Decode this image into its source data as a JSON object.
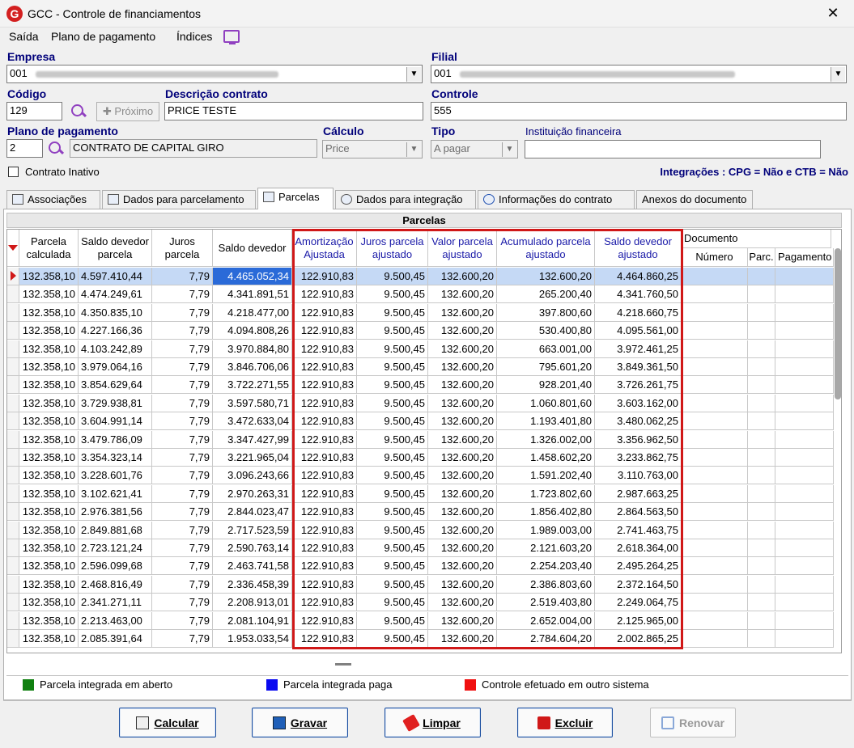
{
  "window": {
    "title": "GCC - Controle de financiamentos",
    "logo_letter": "G",
    "close_glyph": "✕"
  },
  "menu": {
    "items": [
      "Saída",
      "Plano de pagamento",
      "Índices"
    ]
  },
  "form": {
    "empresa_label": "Empresa",
    "empresa_value": "001",
    "filial_label": "Filial",
    "filial_value": "001",
    "codigo_label": "Código",
    "codigo_value": "129",
    "proximo_label": "Próximo",
    "descricao_label": "Descrição contrato",
    "descricao_value": "PRICE TESTE",
    "controle_label": "Controle",
    "controle_value": "555",
    "plano_label": "Plano de pagamento",
    "plano_code": "2",
    "plano_value": "CONTRATO DE CAPITAL GIRO",
    "calculo_label": "Cálculo",
    "calculo_value": "Price",
    "tipo_label": "Tipo",
    "tipo_value": "A pagar",
    "instituicao_label": "Instituição financeira",
    "instituicao_value": "",
    "inativo_label": "Contrato Inativo",
    "integracoes": "Integrações : CPG = Não e CTB = Não"
  },
  "tabs": [
    "Associações",
    "Dados para parcelamento",
    "Parcelas",
    "Dados para integração",
    "Informações do contrato",
    "Anexos do documento"
  ],
  "grid": {
    "caption": "Parcelas",
    "headers": [
      "Parcela calculada",
      "Saldo devedor parcela",
      "Juros parcela",
      "Saldo devedor",
      "Amortização Ajustada",
      "Juros parcela ajustado",
      "Valor parcela ajustado",
      "Acumulado parcela ajustado",
      "Saldo devedor ajustado"
    ],
    "doc_group": "Documento",
    "doc_headers": [
      "Número",
      "Parc.",
      "Pagamento"
    ],
    "rows": [
      [
        "132.358,10",
        "4.597.410,44",
        "7,79",
        "4.465.052,34",
        "122.910,83",
        "9.500,45",
        "132.600,20",
        "132.600,20",
        "4.464.860,25"
      ],
      [
        "132.358,10",
        "4.474.249,61",
        "7,79",
        "4.341.891,51",
        "122.910,83",
        "9.500,45",
        "132.600,20",
        "265.200,40",
        "4.341.760,50"
      ],
      [
        "132.358,10",
        "4.350.835,10",
        "7,79",
        "4.218.477,00",
        "122.910,83",
        "9.500,45",
        "132.600,20",
        "397.800,60",
        "4.218.660,75"
      ],
      [
        "132.358,10",
        "4.227.166,36",
        "7,79",
        "4.094.808,26",
        "122.910,83",
        "9.500,45",
        "132.600,20",
        "530.400,80",
        "4.095.561,00"
      ],
      [
        "132.358,10",
        "4.103.242,89",
        "7,79",
        "3.970.884,80",
        "122.910,83",
        "9.500,45",
        "132.600,20",
        "663.001,00",
        "3.972.461,25"
      ],
      [
        "132.358,10",
        "3.979.064,16",
        "7,79",
        "3.846.706,06",
        "122.910,83",
        "9.500,45",
        "132.600,20",
        "795.601,20",
        "3.849.361,50"
      ],
      [
        "132.358,10",
        "3.854.629,64",
        "7,79",
        "3.722.271,55",
        "122.910,83",
        "9.500,45",
        "132.600,20",
        "928.201,40",
        "3.726.261,75"
      ],
      [
        "132.358,10",
        "3.729.938,81",
        "7,79",
        "3.597.580,71",
        "122.910,83",
        "9.500,45",
        "132.600,20",
        "1.060.801,60",
        "3.603.162,00"
      ],
      [
        "132.358,10",
        "3.604.991,14",
        "7,79",
        "3.472.633,04",
        "122.910,83",
        "9.500,45",
        "132.600,20",
        "1.193.401,80",
        "3.480.062,25"
      ],
      [
        "132.358,10",
        "3.479.786,09",
        "7,79",
        "3.347.427,99",
        "122.910,83",
        "9.500,45",
        "132.600,20",
        "1.326.002,00",
        "3.356.962,50"
      ],
      [
        "132.358,10",
        "3.354.323,14",
        "7,79",
        "3.221.965,04",
        "122.910,83",
        "9.500,45",
        "132.600,20",
        "1.458.602,20",
        "3.233.862,75"
      ],
      [
        "132.358,10",
        "3.228.601,76",
        "7,79",
        "3.096.243,66",
        "122.910,83",
        "9.500,45",
        "132.600,20",
        "1.591.202,40",
        "3.110.763,00"
      ],
      [
        "132.358,10",
        "3.102.621,41",
        "7,79",
        "2.970.263,31",
        "122.910,83",
        "9.500,45",
        "132.600,20",
        "1.723.802,60",
        "2.987.663,25"
      ],
      [
        "132.358,10",
        "2.976.381,56",
        "7,79",
        "2.844.023,47",
        "122.910,83",
        "9.500,45",
        "132.600,20",
        "1.856.402,80",
        "2.864.563,50"
      ],
      [
        "132.358,10",
        "2.849.881,68",
        "7,79",
        "2.717.523,59",
        "122.910,83",
        "9.500,45",
        "132.600,20",
        "1.989.003,00",
        "2.741.463,75"
      ],
      [
        "132.358,10",
        "2.723.121,24",
        "7,79",
        "2.590.763,14",
        "122.910,83",
        "9.500,45",
        "132.600,20",
        "2.121.603,20",
        "2.618.364,00"
      ],
      [
        "132.358,10",
        "2.596.099,68",
        "7,79",
        "2.463.741,58",
        "122.910,83",
        "9.500,45",
        "132.600,20",
        "2.254.203,40",
        "2.495.264,25"
      ],
      [
        "132.358,10",
        "2.468.816,49",
        "7,79",
        "2.336.458,39",
        "122.910,83",
        "9.500,45",
        "132.600,20",
        "2.386.803,60",
        "2.372.164,50"
      ],
      [
        "132.358,10",
        "2.341.271,11",
        "7,79",
        "2.208.913,01",
        "122.910,83",
        "9.500,45",
        "132.600,20",
        "2.519.403,80",
        "2.249.064,75"
      ],
      [
        "132.358,10",
        "2.213.463,00",
        "7,79",
        "2.081.104,91",
        "122.910,83",
        "9.500,45",
        "132.600,20",
        "2.652.004,00",
        "2.125.965,00"
      ],
      [
        "132.358,10",
        "2.085.391,64",
        "7,79",
        "1.953.033,54",
        "122.910,83",
        "9.500,45",
        "132.600,20",
        "2.784.604,20",
        "2.002.865,25"
      ]
    ]
  },
  "legend": [
    {
      "label": "Parcela integrada em aberto",
      "color": "#108010"
    },
    {
      "label": "Parcela integrada paga",
      "color": "#0a0af0"
    },
    {
      "label": "Controle efetuado em outro sistema",
      "color": "#f01010"
    }
  ],
  "buttons": {
    "calcular": "Calcular",
    "gravar": "Gravar",
    "limpar": "Limpar",
    "excluir": "Excluir",
    "renovar": "Renovar"
  }
}
